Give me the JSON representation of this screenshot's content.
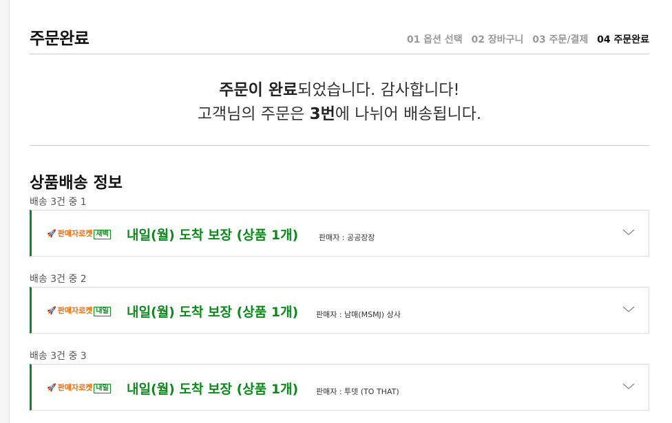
{
  "header": {
    "title": "주문완료",
    "steps": [
      "01 옵션 선택",
      "02 장바구니",
      "03 주문/결제",
      "04 주문완료"
    ]
  },
  "message": {
    "line1_strong": "주문이 완료",
    "line1_rest": "되었습니다. 감사합니다!",
    "line2_pre": "고객님의 주문은 ",
    "line2_strong": "3번",
    "line2_post": "에 나뉘어 배송됩니다."
  },
  "section": {
    "title": "상품배송 정보"
  },
  "shipments": [
    {
      "label": "배송 3건 중 1",
      "badge": "판매자로켓",
      "badge_tag": "새벽",
      "delivery": "내일(월) 도착 보장 (상품 1개)",
      "seller": "판매자 : 공공장장"
    },
    {
      "label": "배송 3건 중 2",
      "badge": "판매자로켓",
      "badge_tag": "내일",
      "delivery": "내일(월) 도착 보장 (상품 1개)",
      "seller": "판매자 : 남매(MSMJ) 상사"
    },
    {
      "label": "배송 3건 중 3",
      "badge": "판매자로켓",
      "badge_tag": "내일",
      "delivery": "내일(월) 도착 보장 (상품 1개)",
      "seller": "판매자 : 투뎃 (TO THAT)"
    }
  ],
  "colors": {
    "accent": "#0a8a1a",
    "rocket": "#ff6a00"
  }
}
